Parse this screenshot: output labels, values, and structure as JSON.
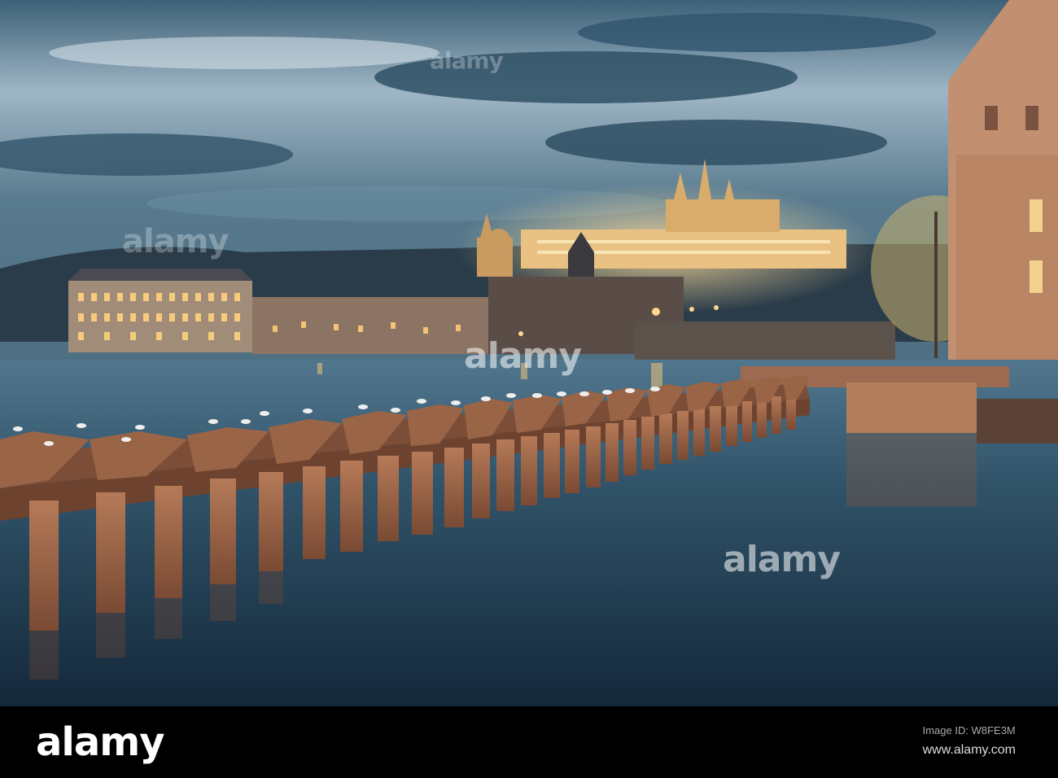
{
  "watermark": {
    "text": "alamy"
  },
  "footer": {
    "logo": "alamy",
    "image_id_label": "Image ID: W8FE3M",
    "url": "www.alamy.com"
  },
  "palette": {
    "sky_top": "#2b4a60",
    "sky_light": "#cfdce5",
    "water": "#2a4658",
    "glow": "#f1c27b",
    "timber": "#8e5a3e"
  }
}
